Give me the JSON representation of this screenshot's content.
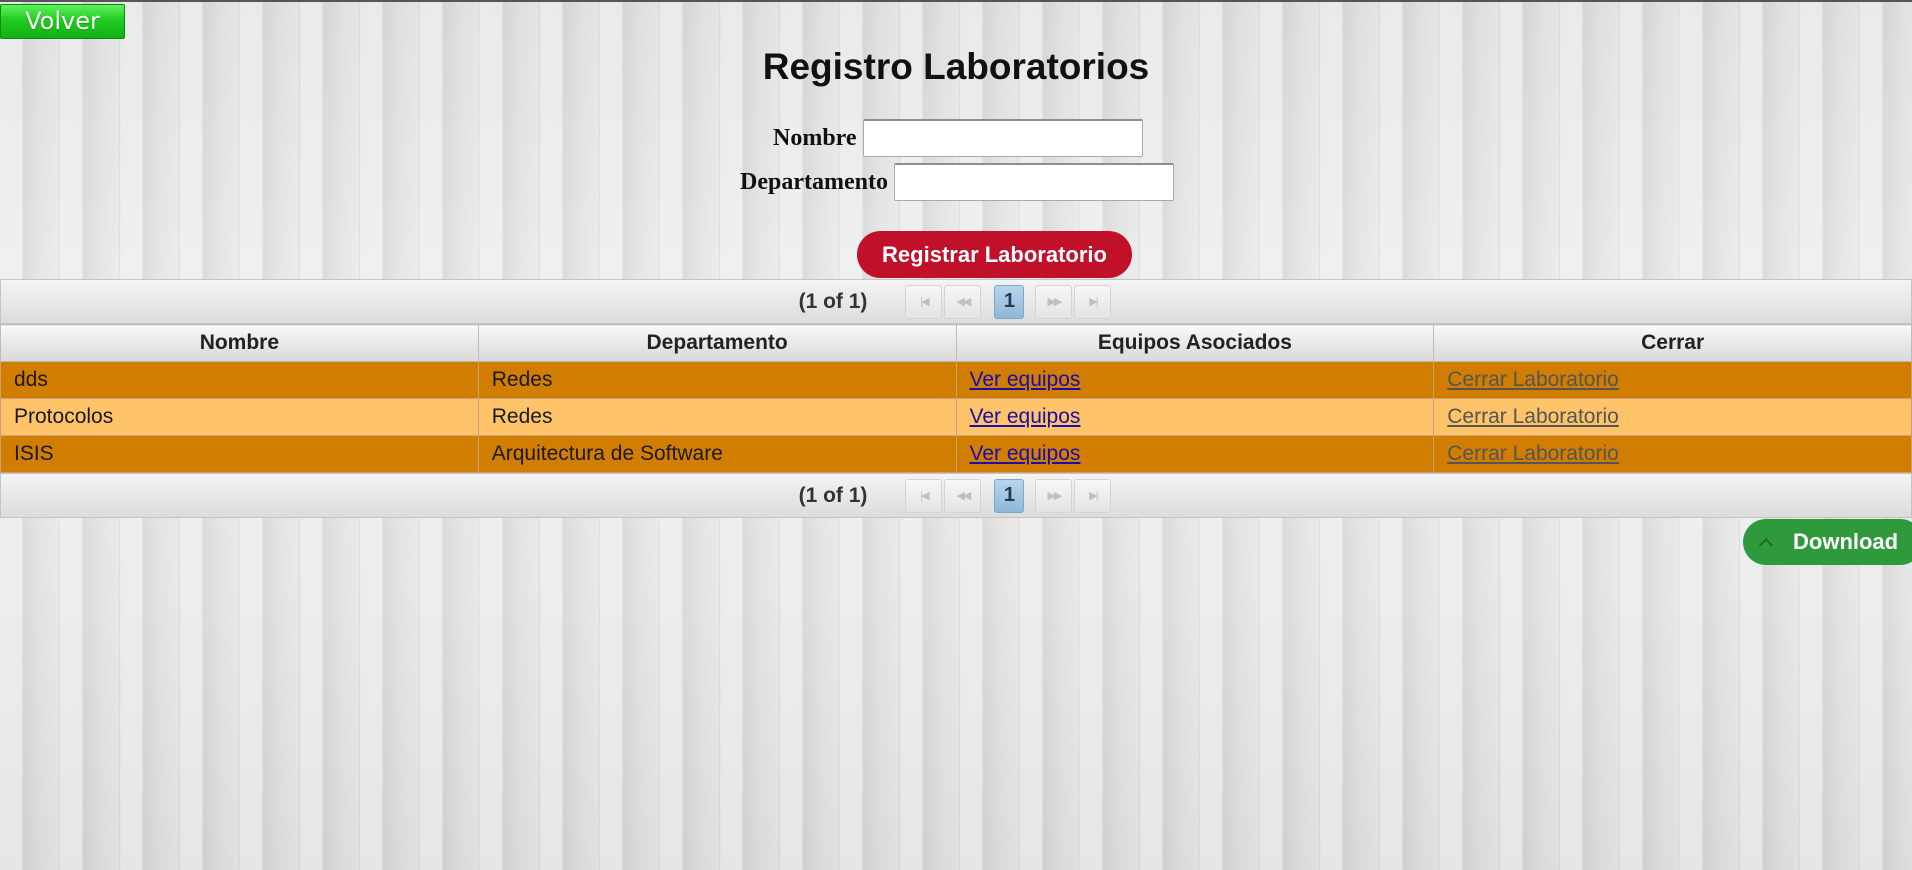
{
  "back_button": {
    "label": "Volver"
  },
  "page": {
    "title": "Registro Laboratorios"
  },
  "form": {
    "nombre": {
      "label": "Nombre",
      "value": ""
    },
    "departamento": {
      "label": "Departamento",
      "value": ""
    },
    "submit_label": "Registrar Laboratorio"
  },
  "table": {
    "paginator": {
      "current": "(1 of 1)",
      "page": "1"
    },
    "columns": [
      "Nombre",
      "Departamento",
      "Equipos Asociados",
      "Cerrar"
    ],
    "rows": [
      {
        "nombre": "dds",
        "departamento": "Redes",
        "equipos": "Ver equipos",
        "cerrar": "Cerrar Laboratorio"
      },
      {
        "nombre": "Protocolos",
        "departamento": "Redes",
        "equipos": "Ver equipos",
        "cerrar": "Cerrar Laboratorio"
      },
      {
        "nombre": "ISIS",
        "departamento": "Arquitectura de Software",
        "equipos": "Ver equipos",
        "cerrar": "Cerrar Laboratorio"
      }
    ]
  },
  "download": {
    "label": "Download",
    "icon": "chevron-up-icon"
  },
  "colors": {
    "back_button": "#22cc22",
    "register_button": "#c0102a",
    "row_odd": "#d17d00",
    "row_even": "#ffc46a",
    "download_button": "#2e9a3c"
  }
}
